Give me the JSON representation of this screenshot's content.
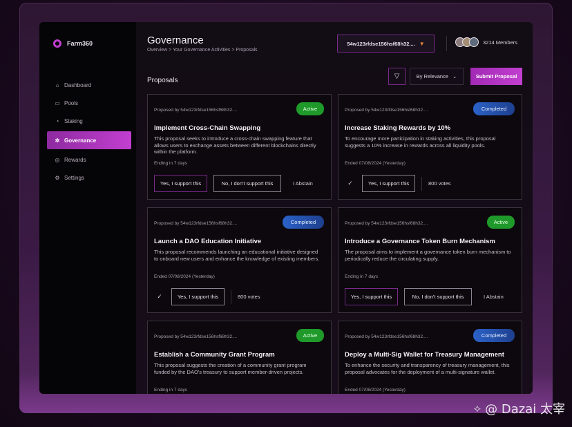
{
  "app": {
    "logo_text": "Farm360",
    "header_title": "Governance",
    "breadcrumb": "Overview > Your Governance Activities > Proposals",
    "wallet_address": "54w123rfdse156hsf68h32....",
    "members_text": "3214 Members"
  },
  "sidebar": {
    "items": [
      {
        "label": "Dashboard",
        "icon": "home-icon"
      },
      {
        "label": "Pools",
        "icon": "pools-icon"
      },
      {
        "label": "Staking",
        "icon": "staking-icon"
      },
      {
        "label": "Governance",
        "icon": "governance-icon",
        "active": true
      },
      {
        "label": "Rewards",
        "icon": "rewards-icon"
      },
      {
        "label": "Settings",
        "icon": "gear-icon"
      }
    ]
  },
  "toolbar": {
    "section_title": "Proposals",
    "sort_label": "By Relevance",
    "submit_label": "Submit Proposal"
  },
  "proposals": [
    {
      "proposer": "Proposed by 54w123rfdse156hsf68h32....",
      "status": "Active",
      "title": "Implement Cross-Chain Swapping",
      "description": "This proposal seeks to introduce a cross-chain swapping feature that allows users to exchange assets between different blockchains directly within the platform.",
      "meta": "Ending in 7 days",
      "yes_label": "Yes, I support this",
      "no_label": "No, I don't support this",
      "abstain_label": "I Abstain"
    },
    {
      "proposer": "Proposed by 54w123rfdse156hsf68h32....",
      "status": "Completed",
      "title": "Increase Staking Rewards by 10%",
      "description": "To encourage more participation in staking activities, this proposal suggests a 10% increase in rewards across all liquidity pools.",
      "meta": "Ended 07/08/2024 (Yesterday)",
      "yes_label": "Yes, I support this",
      "votes": "800 votes"
    },
    {
      "proposer": "Proposed by 54w123rfdse156hsf68h32....",
      "status": "Completed",
      "title": "Launch a DAO Education Initiative",
      "description": "This proposal recommends launching an educational initiative designed to onboard new users and enhance the knowledge of existing members.",
      "meta": "Ended 07/08/2024 (Yesterday)",
      "yes_label": "Yes, I support this",
      "votes": "800 votes"
    },
    {
      "proposer": "Proposed by 54w123rfdse156hsf68h32....",
      "status": "Active",
      "title": "Introduce a Governance Token Burn Mechanism",
      "description": "The proposal aims to implement a governance token burn mechanism to periodically reduce the circulating supply.",
      "meta": "Ending in 7 days",
      "yes_label": "Yes, I support this",
      "no_label": "No, I don't support this",
      "abstain_label": "I Abstain"
    },
    {
      "proposer": "Proposed by 54w123rfdse156hsf68h32....",
      "status": "Active",
      "title": "Establish a Community Grant Program",
      "description": "This proposal suggests the creation of a community grant program funded by the DAO's treasury to support member-driven projects.",
      "meta": "Ending in 7 days"
    },
    {
      "proposer": "Proposed by 54w123rfdse156hsf68h32....",
      "status": "Completed",
      "title": "Deploy a Multi-Sig Wallet for Treasury Management",
      "description": "To enhance the security and transparency of treasury management, this proposal advocates for the deployment of a multi-signature wallet.",
      "meta": "Ended 07/08/2024 (Yesterday)"
    }
  ],
  "watermark": "@ Dazai 太宰",
  "colors": {
    "accent": "#c23fd0",
    "active_badge": "#1f9a2a",
    "completed_badge": "#2b62c8"
  }
}
